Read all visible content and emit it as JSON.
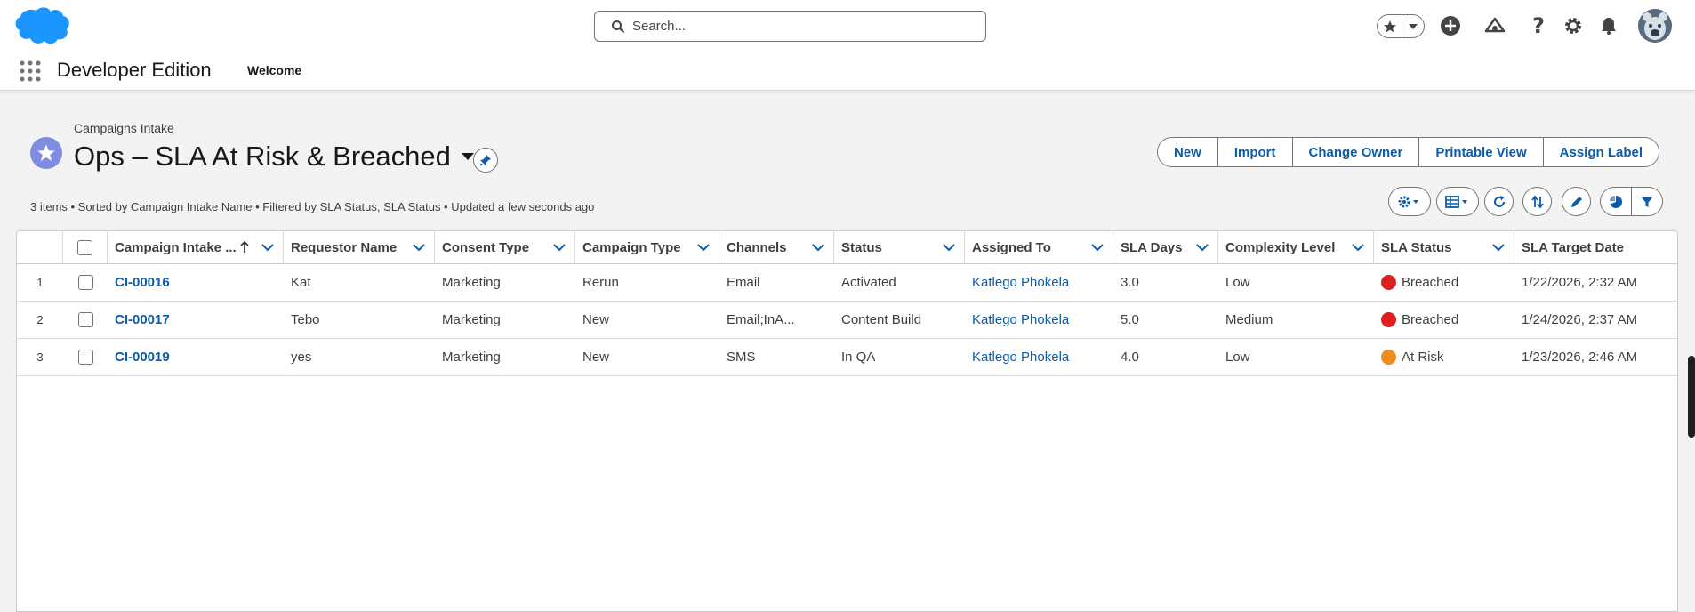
{
  "global_header": {
    "search_placeholder": "Search...",
    "icons": [
      "cloud-logo",
      "search-icon",
      "favorites-star-icon",
      "favorites-dropdown-icon",
      "add-icon",
      "trailhead-icon",
      "help-icon",
      "setup-gear-icon",
      "notifications-bell-icon",
      "user-avatar"
    ]
  },
  "app_nav": {
    "app_name": "Developer Edition",
    "items": [
      {
        "label": "Welcome"
      }
    ]
  },
  "list_header": {
    "object_label": "Campaigns Intake",
    "title": "Ops – SLA At Risk & Breached",
    "meta": "3 items • Sorted by Campaign Intake Name • Filtered by SLA Status, SLA Status • Updated a few seconds ago",
    "buttons": [
      "New",
      "Import",
      "Change Owner",
      "Printable View",
      "Assign Label"
    ],
    "tool_icons": [
      "list-settings-icon",
      "display-as-table-icon",
      "refresh-icon",
      "sort-icon",
      "inline-edit-icon",
      "charts-icon",
      "filter-icon"
    ]
  },
  "table": {
    "columns": [
      "Campaign Intake ...",
      "Requestor Name",
      "Consent Type",
      "Campaign Type",
      "Channels",
      "Status",
      "Assigned To",
      "SLA Days",
      "Complexity Level",
      "SLA Status",
      "SLA Target Date"
    ],
    "rows": [
      {
        "num": "1",
        "name": "CI-00016",
        "requestor": "Kat",
        "consent": "Marketing",
        "campaign_type": "Rerun",
        "channels": "Email",
        "status": "Activated",
        "assigned": "Katlego Phokela",
        "sla_days": "3.0",
        "complexity": "Low",
        "sla_status": "Breached",
        "sla_color": "#e02020",
        "target": "1/22/2026, 2:32 AM"
      },
      {
        "num": "2",
        "name": "CI-00017",
        "requestor": "Tebo",
        "consent": "Marketing",
        "campaign_type": "New",
        "channels": "Email;InA...",
        "status": "Content Build",
        "assigned": "Katlego Phokela",
        "sla_days": "5.0",
        "complexity": "Medium",
        "sla_status": "Breached",
        "sla_color": "#e02020",
        "target": "1/24/2026, 2:37 AM"
      },
      {
        "num": "3",
        "name": "CI-00019",
        "requestor": "yes",
        "consent": "Marketing",
        "campaign_type": "New",
        "channels": "SMS",
        "status": "In QA",
        "assigned": "Katlego Phokela",
        "sla_days": "4.0",
        "complexity": "Low",
        "sla_status": "At Risk",
        "sla_color": "#f08c1a",
        "target": "1/23/2026, 2:46 AM"
      }
    ]
  },
  "colors": {
    "brand_blue": "#0b5cab",
    "logo_blue": "#1b96ff",
    "list_icon": "#7f8de1"
  }
}
